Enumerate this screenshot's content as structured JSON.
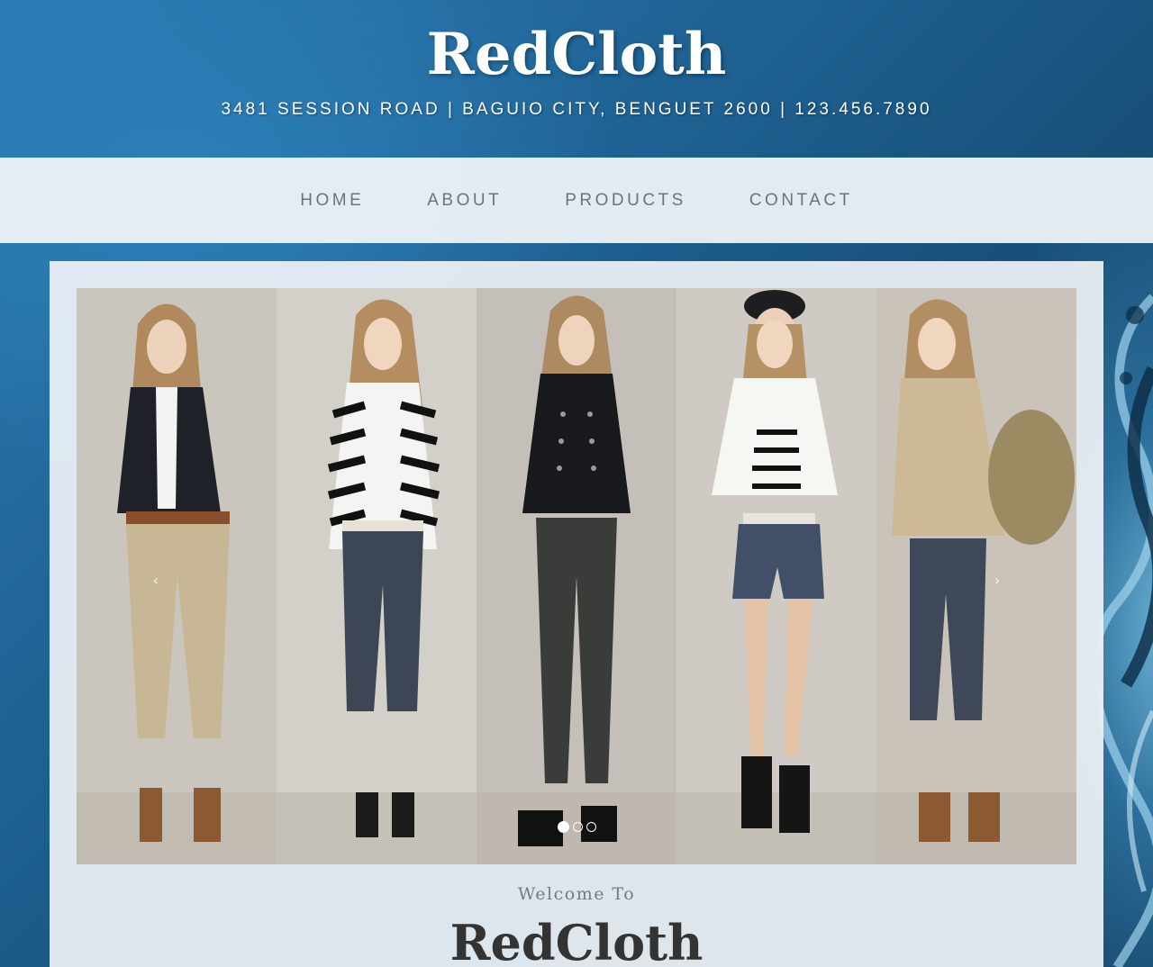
{
  "header": {
    "brand": "RedCloth",
    "address": "3481 SESSION ROAD | BAGUIO CITY, BENGUET 2600 | 123.456.7890"
  },
  "nav": {
    "items": [
      {
        "label": "HOME"
      },
      {
        "label": "ABOUT"
      },
      {
        "label": "PRODUCTS"
      },
      {
        "label": "CONTACT"
      }
    ]
  },
  "carousel": {
    "prev_label": "‹",
    "next_label": "›",
    "slide_count": 3,
    "active_slide": 1,
    "image_alt": "five models wearing jackets and jeans"
  },
  "welcome": {
    "intro": "Welcome To",
    "brand": "RedCloth"
  },
  "colors": {
    "background": "#1d5f8f",
    "nav_bg": "#eef2f6",
    "nav_text": "#6e7378",
    "brand_text": "#ffffff",
    "welcome_brand": "#333333"
  }
}
